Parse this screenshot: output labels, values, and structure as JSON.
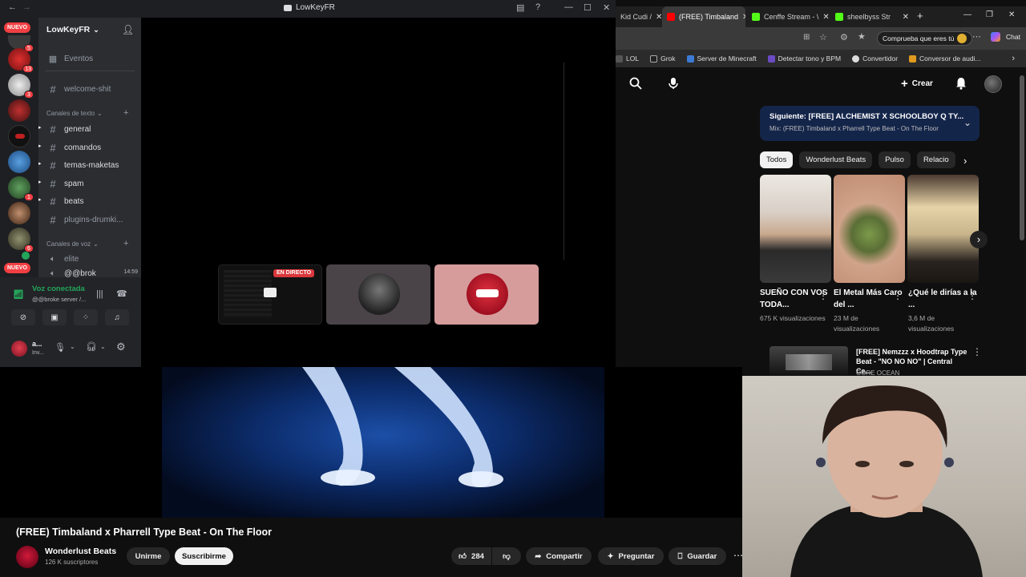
{
  "discord": {
    "window_title": "LowKeyFR",
    "server_name": "LowKeyFR",
    "nuevo_label": "NUEVO",
    "server_badges": [
      "5",
      "13",
      "3",
      "1",
      "6"
    ],
    "events_label": "Eventos",
    "channels_top": [
      {
        "name": "welcome-shit",
        "muted": true
      }
    ],
    "text_category": "Canales de texto",
    "text_channels": [
      {
        "name": "general",
        "unread": true
      },
      {
        "name": "comandos",
        "unread": true
      },
      {
        "name": "temas-maketas",
        "unread": true
      },
      {
        "name": "spam",
        "unread": true
      },
      {
        "name": "beats",
        "unread": true
      },
      {
        "name": "plugins-drumki...",
        "unread": false
      }
    ],
    "voice_category": "Canales de voz",
    "voice_channels": [
      {
        "name": "elite"
      },
      {
        "name": "@@brok",
        "time": "14:59"
      }
    ],
    "voice_status": "Voz conectada",
    "voice_server": "@@broke server /...",
    "user_name": "a...",
    "user_status": "Inv...",
    "live_label": "EN DIRECTO"
  },
  "browser": {
    "tabs": [
      {
        "label": "Kid Cudi /",
        "active": false,
        "color": "#e0e0e0"
      },
      {
        "label": "(FREE) Timbaland",
        "active": true,
        "color": "#ff0000"
      },
      {
        "label": "Cenffe Stream - \\",
        "active": false,
        "color": "#53fc18"
      },
      {
        "label": "sheelbyss Str",
        "active": false,
        "color": "#53fc18"
      }
    ],
    "check_pill": "Comprueba que eres tú",
    "chat_label": "Chat",
    "bookmarks": [
      {
        "label": "LOL",
        "color": "#555555"
      },
      {
        "label": "Grok",
        "color": "#222222"
      },
      {
        "label": "Server de Minecraft",
        "color": "#3b7bd4"
      },
      {
        "label": "Detectar tono y BPM",
        "color": "#6a4bc4"
      },
      {
        "label": "Convertidor",
        "color": "#dddddd"
      },
      {
        "label": "Conversor de audi...",
        "color": "#e09a20"
      }
    ]
  },
  "youtube": {
    "create_label": "Crear",
    "next_title": "Siguiente: [FREE] ALCHEMIST X SCHOOLBOY Q TY...",
    "next_mix": "Mix: (FREE) Timbaland x Pharrell Type Beat - On The Floor",
    "chips": [
      "Todos",
      "Wonderlust Beats",
      "Pulso",
      "Relacio"
    ],
    "shorts": [
      {
        "title": "SUEÑO CON VOS TODA...",
        "views": "675 K visualizaciones"
      },
      {
        "title": "El Metal Más Caro del ...",
        "views": "23 M de visualizaciones"
      },
      {
        "title": "¿Qué le dirías a la ...",
        "views": "3,6 M de visualizaciones"
      }
    ],
    "rec_title": "[FREE] Nemzzz x Hoodtrap Type Beat - \"NO NO NO\" | Central Ce...",
    "rec_channel": "GORE OCEAN",
    "video_title": "(FREE) Timbaland x Pharrell Type Beat - On The Floor",
    "channel_name": "Wonderlust Beats",
    "channel_subs": "126 K suscriptores",
    "join_label": "Unirme",
    "subscribe_label": "Suscribirme",
    "likes": "284",
    "share_label": "Compartir",
    "ask_label": "Preguntar",
    "save_label": "Guardar"
  }
}
